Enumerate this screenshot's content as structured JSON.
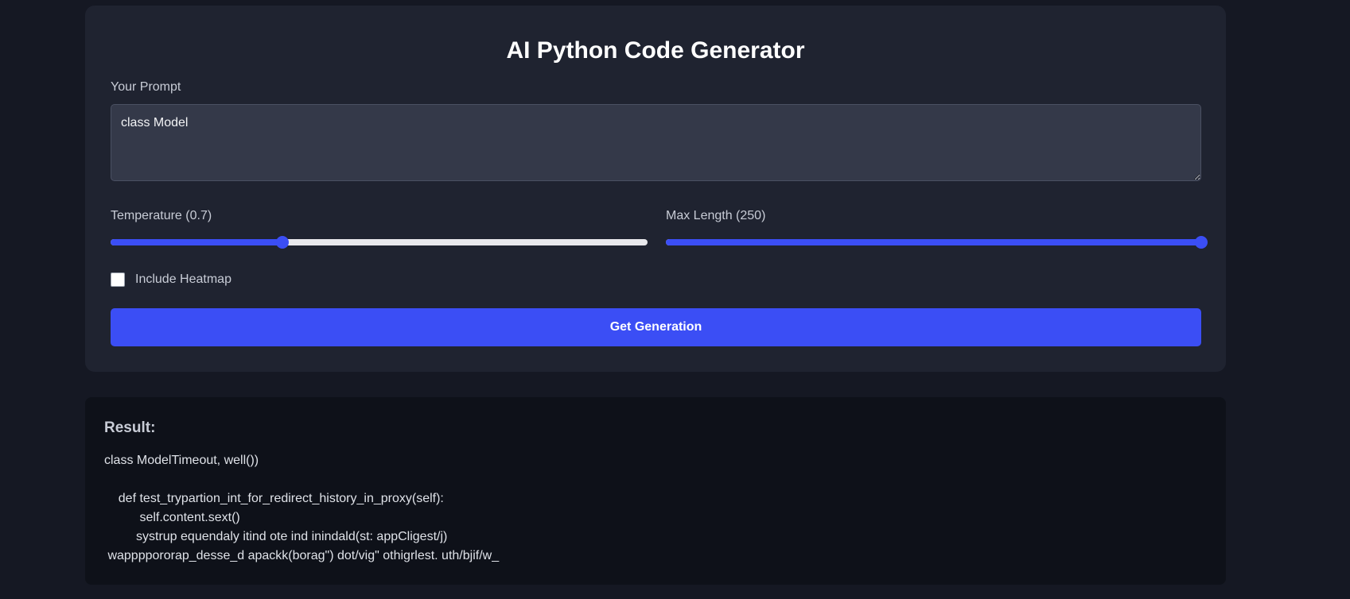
{
  "page": {
    "title": "AI Python Code Generator"
  },
  "prompt": {
    "label": "Your Prompt",
    "value": "class Model"
  },
  "temperature": {
    "label": "Temperature (0.7)",
    "value": 0.7,
    "fraction": 0.32
  },
  "max_length": {
    "label": "Max Length (250)",
    "value": 250,
    "fraction": 1.0
  },
  "heatmap": {
    "label": "Include Heatmap",
    "checked": false
  },
  "generate_button": {
    "label": "Get Generation"
  },
  "result": {
    "title": "Result:",
    "text": "class ModelTimeout, well())\n\n    def test_trypartion_int_for_redirect_history_in_proxy(self):\n          self.content.sext()\n         systrup equendaly itind ote ind inindald(st: appCligest/j)\n wappppororap_desse_d apackk(borag\") dot/vig\" othigrlest. uth/bjif/w_"
  },
  "colors": {
    "accent": "#3b4ef5",
    "card_bg": "#1f2330",
    "page_bg": "#151823",
    "result_bg": "#0e1119"
  }
}
